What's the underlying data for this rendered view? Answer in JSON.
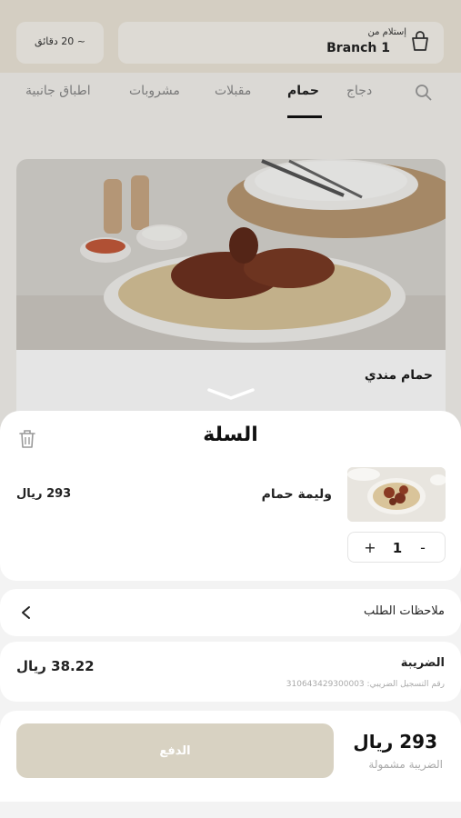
{
  "header": {
    "pickup_label": "إستلام من",
    "branch": "Branch 1",
    "prep_time": "~ 20 دقائق"
  },
  "tabs": [
    {
      "label": "دجاج"
    },
    {
      "label": "حمام"
    },
    {
      "label": "مقبلات"
    },
    {
      "label": "مشروبات"
    },
    {
      "label": "اطباق جانبية"
    }
  ],
  "menu_item": {
    "name": "حمام مندي"
  },
  "cart": {
    "title": "السلة",
    "item": {
      "name": "وليمة حمام",
      "price": "293 ريال",
      "quantity": "1"
    },
    "notes_label": "ملاحظات الطلب",
    "tax_label": "الضريبة",
    "tax_value": "38.22 ريال",
    "tax_reg": "رقم التسجيل الضريبي: 310643429300003",
    "total": "293 ريال",
    "total_note": "الضريبة مشمولة",
    "pay_label": "الدفع"
  },
  "colors": {
    "accent": "#d8d2c2",
    "header_bg": "#ece6d8"
  }
}
